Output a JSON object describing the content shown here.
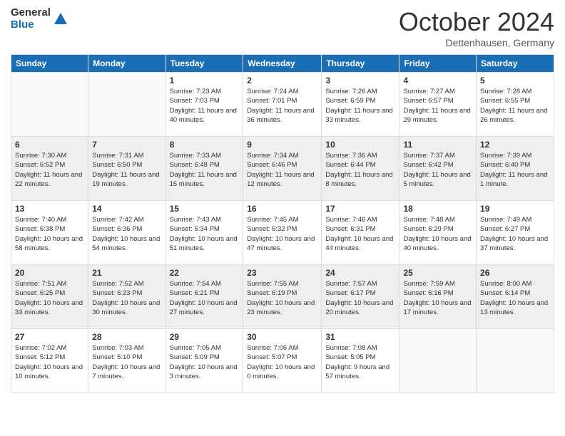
{
  "header": {
    "logo_general": "General",
    "logo_blue": "Blue",
    "month_title": "October 2024",
    "location": "Dettenhausen, Germany"
  },
  "days_of_week": [
    "Sunday",
    "Monday",
    "Tuesday",
    "Wednesday",
    "Thursday",
    "Friday",
    "Saturday"
  ],
  "weeks": [
    [
      {
        "day": "",
        "info": ""
      },
      {
        "day": "",
        "info": ""
      },
      {
        "day": "1",
        "info": "Sunrise: 7:23 AM\nSunset: 7:03 PM\nDaylight: 11 hours and 40 minutes."
      },
      {
        "day": "2",
        "info": "Sunrise: 7:24 AM\nSunset: 7:01 PM\nDaylight: 11 hours and 36 minutes."
      },
      {
        "day": "3",
        "info": "Sunrise: 7:26 AM\nSunset: 6:59 PM\nDaylight: 11 hours and 33 minutes."
      },
      {
        "day": "4",
        "info": "Sunrise: 7:27 AM\nSunset: 6:57 PM\nDaylight: 11 hours and 29 minutes."
      },
      {
        "day": "5",
        "info": "Sunrise: 7:28 AM\nSunset: 6:55 PM\nDaylight: 11 hours and 26 minutes."
      }
    ],
    [
      {
        "day": "6",
        "info": "Sunrise: 7:30 AM\nSunset: 6:52 PM\nDaylight: 11 hours and 22 minutes."
      },
      {
        "day": "7",
        "info": "Sunrise: 7:31 AM\nSunset: 6:50 PM\nDaylight: 11 hours and 19 minutes."
      },
      {
        "day": "8",
        "info": "Sunrise: 7:33 AM\nSunset: 6:48 PM\nDaylight: 11 hours and 15 minutes."
      },
      {
        "day": "9",
        "info": "Sunrise: 7:34 AM\nSunset: 6:46 PM\nDaylight: 11 hours and 12 minutes."
      },
      {
        "day": "10",
        "info": "Sunrise: 7:36 AM\nSunset: 6:44 PM\nDaylight: 11 hours and 8 minutes."
      },
      {
        "day": "11",
        "info": "Sunrise: 7:37 AM\nSunset: 6:42 PM\nDaylight: 11 hours and 5 minutes."
      },
      {
        "day": "12",
        "info": "Sunrise: 7:39 AM\nSunset: 6:40 PM\nDaylight: 11 hours and 1 minute."
      }
    ],
    [
      {
        "day": "13",
        "info": "Sunrise: 7:40 AM\nSunset: 6:38 PM\nDaylight: 10 hours and 58 minutes."
      },
      {
        "day": "14",
        "info": "Sunrise: 7:42 AM\nSunset: 6:36 PM\nDaylight: 10 hours and 54 minutes."
      },
      {
        "day": "15",
        "info": "Sunrise: 7:43 AM\nSunset: 6:34 PM\nDaylight: 10 hours and 51 minutes."
      },
      {
        "day": "16",
        "info": "Sunrise: 7:45 AM\nSunset: 6:32 PM\nDaylight: 10 hours and 47 minutes."
      },
      {
        "day": "17",
        "info": "Sunrise: 7:46 AM\nSunset: 6:31 PM\nDaylight: 10 hours and 44 minutes."
      },
      {
        "day": "18",
        "info": "Sunrise: 7:48 AM\nSunset: 6:29 PM\nDaylight: 10 hours and 40 minutes."
      },
      {
        "day": "19",
        "info": "Sunrise: 7:49 AM\nSunset: 6:27 PM\nDaylight: 10 hours and 37 minutes."
      }
    ],
    [
      {
        "day": "20",
        "info": "Sunrise: 7:51 AM\nSunset: 6:25 PM\nDaylight: 10 hours and 33 minutes."
      },
      {
        "day": "21",
        "info": "Sunrise: 7:52 AM\nSunset: 6:23 PM\nDaylight: 10 hours and 30 minutes."
      },
      {
        "day": "22",
        "info": "Sunrise: 7:54 AM\nSunset: 6:21 PM\nDaylight: 10 hours and 27 minutes."
      },
      {
        "day": "23",
        "info": "Sunrise: 7:55 AM\nSunset: 6:19 PM\nDaylight: 10 hours and 23 minutes."
      },
      {
        "day": "24",
        "info": "Sunrise: 7:57 AM\nSunset: 6:17 PM\nDaylight: 10 hours and 20 minutes."
      },
      {
        "day": "25",
        "info": "Sunrise: 7:59 AM\nSunset: 6:16 PM\nDaylight: 10 hours and 17 minutes."
      },
      {
        "day": "26",
        "info": "Sunrise: 8:00 AM\nSunset: 6:14 PM\nDaylight: 10 hours and 13 minutes."
      }
    ],
    [
      {
        "day": "27",
        "info": "Sunrise: 7:02 AM\nSunset: 5:12 PM\nDaylight: 10 hours and 10 minutes."
      },
      {
        "day": "28",
        "info": "Sunrise: 7:03 AM\nSunset: 5:10 PM\nDaylight: 10 hours and 7 minutes."
      },
      {
        "day": "29",
        "info": "Sunrise: 7:05 AM\nSunset: 5:09 PM\nDaylight: 10 hours and 3 minutes."
      },
      {
        "day": "30",
        "info": "Sunrise: 7:06 AM\nSunset: 5:07 PM\nDaylight: 10 hours and 0 minutes."
      },
      {
        "day": "31",
        "info": "Sunrise: 7:08 AM\nSunset: 5:05 PM\nDaylight: 9 hours and 57 minutes."
      },
      {
        "day": "",
        "info": ""
      },
      {
        "day": "",
        "info": ""
      }
    ]
  ]
}
